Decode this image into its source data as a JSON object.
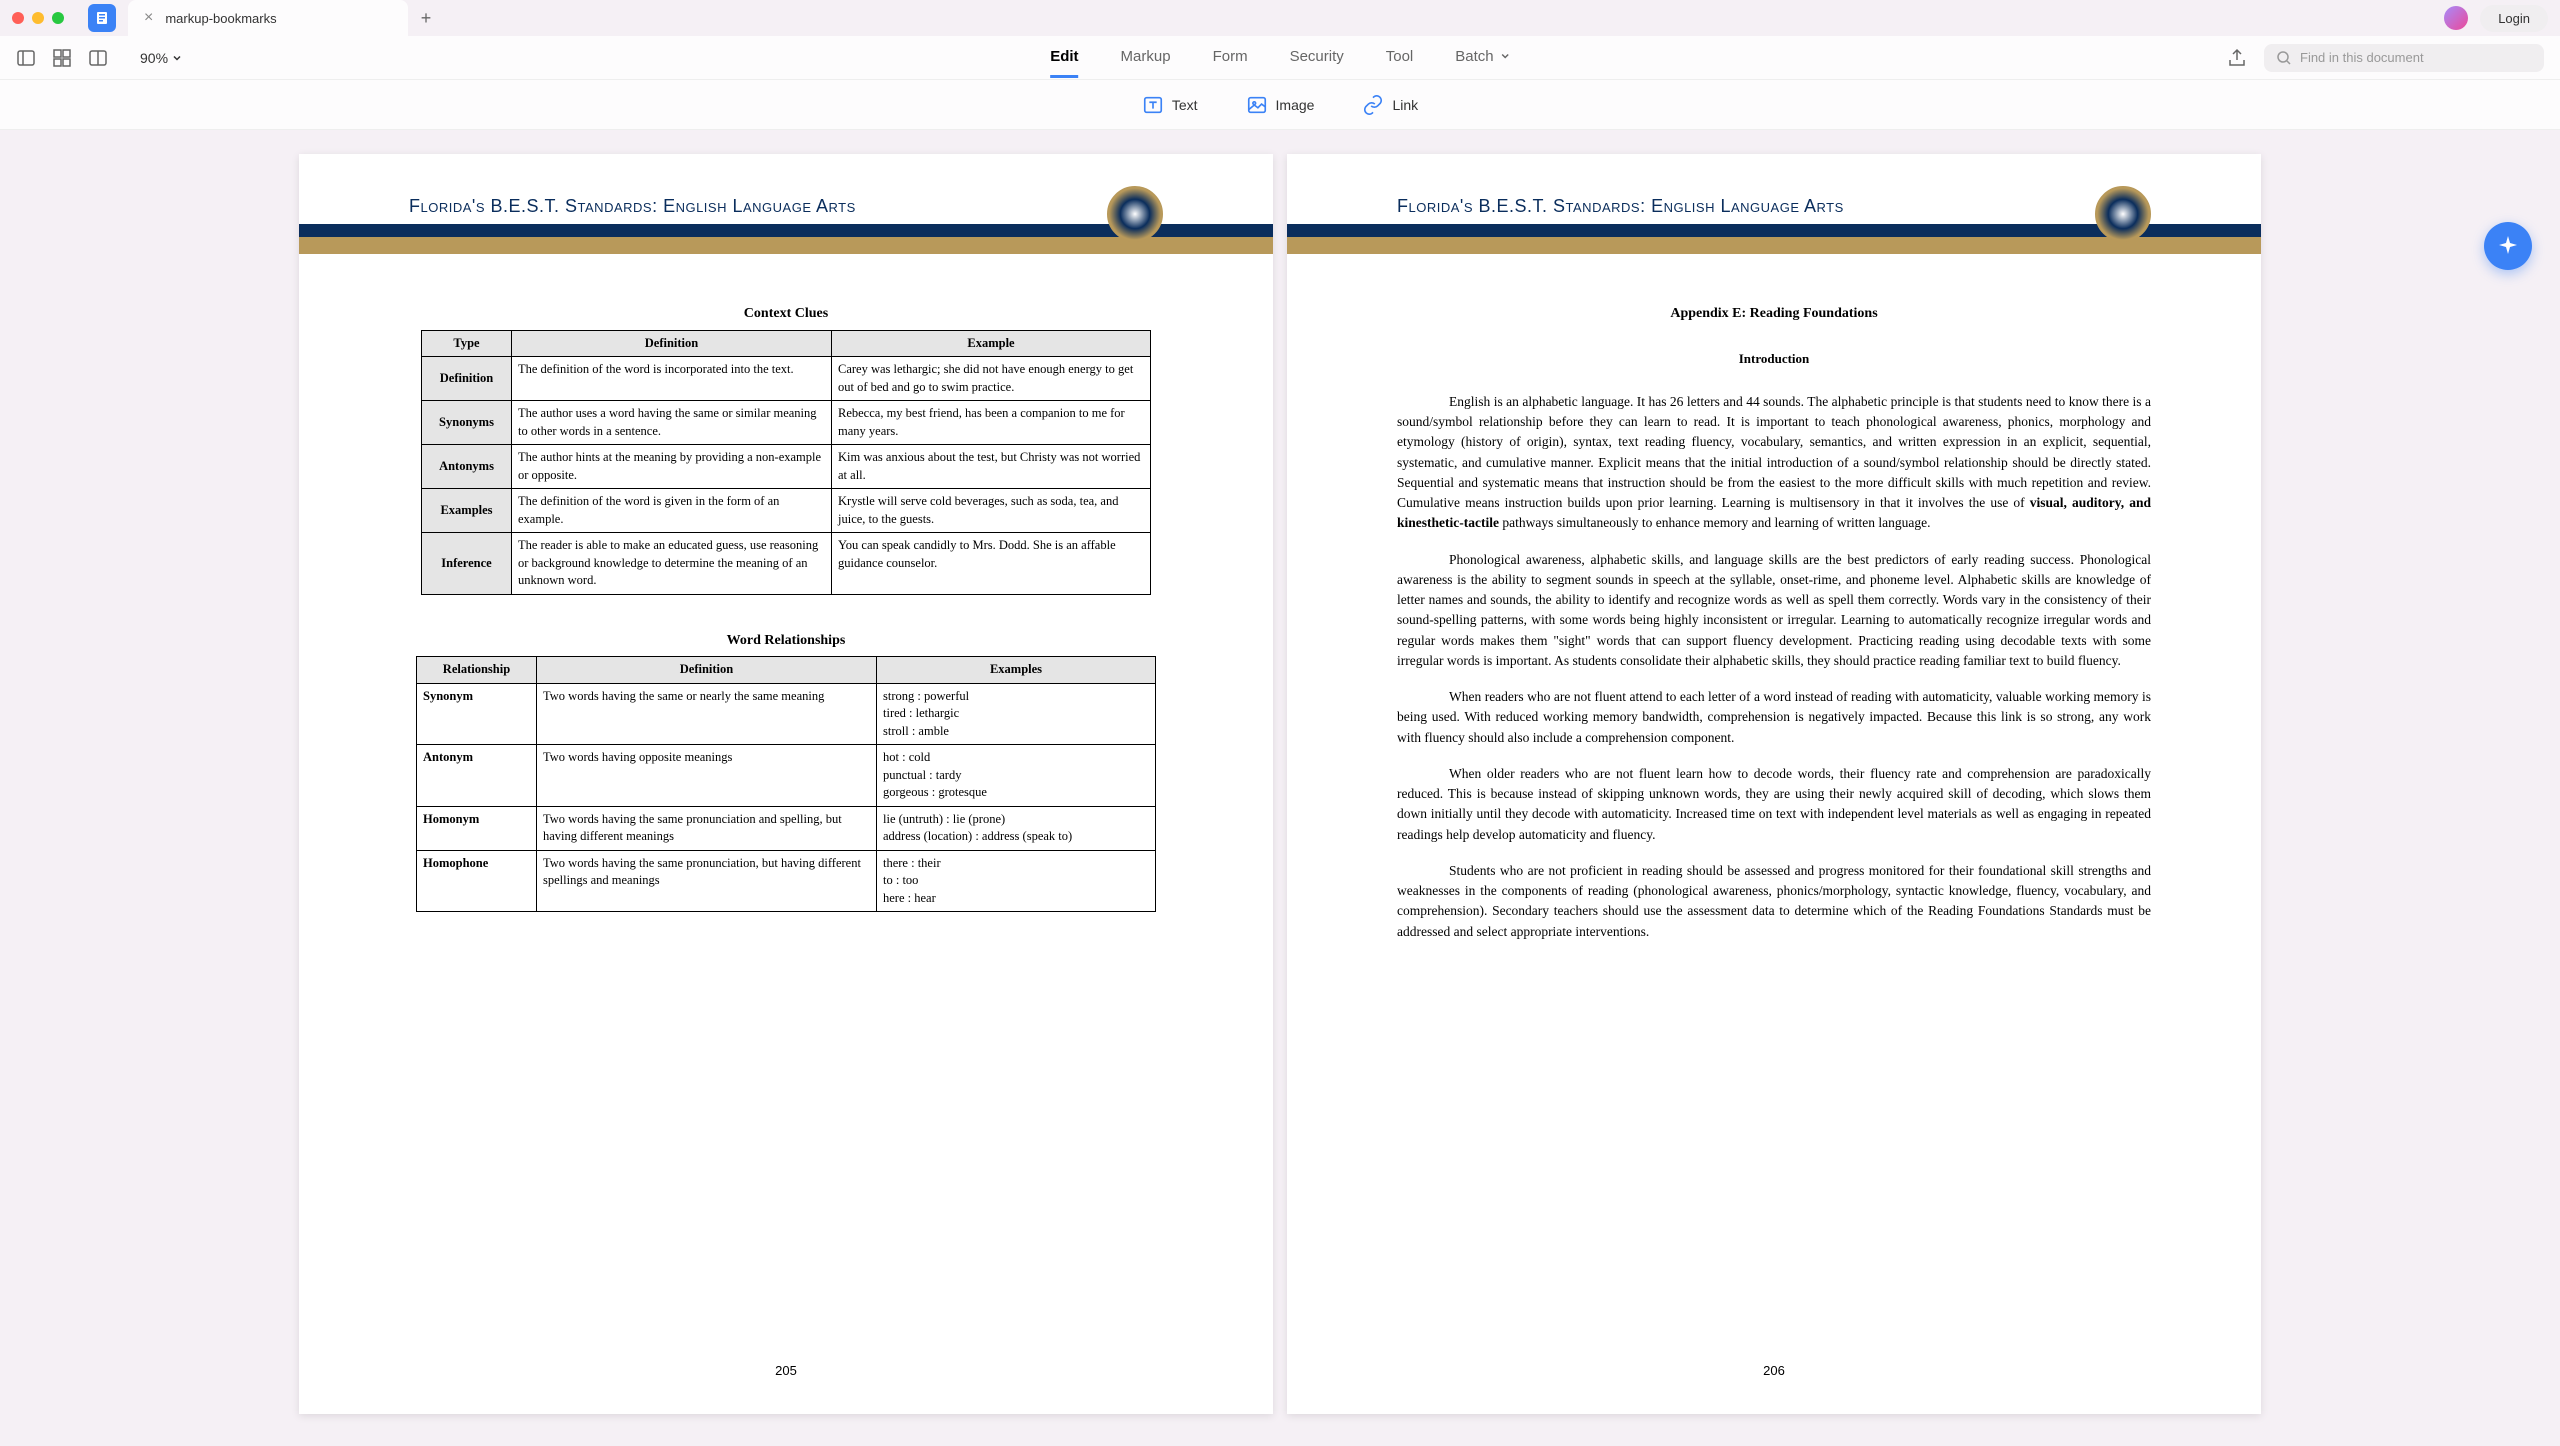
{
  "tab": {
    "title": "markup-bookmarks"
  },
  "login": "Login",
  "zoom": "90%",
  "menu": [
    "Edit",
    "Markup",
    "Form",
    "Security",
    "Tool",
    "Batch"
  ],
  "active_menu_index": 0,
  "tools": {
    "text": "Text",
    "image": "Image",
    "link": "Link"
  },
  "search": {
    "placeholder": "Find in this document"
  },
  "pages": {
    "left": {
      "header": "Florida's B.E.S.T. Standards: English Language Arts",
      "section1_title": "Context Clues",
      "table1": {
        "headers": [
          "Type",
          "Definition",
          "Example"
        ],
        "rows": [
          [
            "Definition",
            "The definition of the word is incorporated into the text.",
            "Carey was lethargic; she did not have enough energy to get out of bed and go to swim practice."
          ],
          [
            "Synonyms",
            "The author uses a word having the same or similar meaning to other words in a sentence.",
            "Rebecca, my best friend, has been a companion to me for many years."
          ],
          [
            "Antonyms",
            "The author hints at the meaning by providing a non-example or opposite.",
            "Kim was anxious about the test, but Christy was not worried at all."
          ],
          [
            "Examples",
            "The definition of the word is given in the form of an example.",
            "Krystle will serve cold beverages, such as soda, tea, and juice, to the guests."
          ],
          [
            "Inference",
            "The reader is able to make an educated guess, use reasoning or background knowledge to determine the meaning of an unknown word.",
            "You can speak candidly to Mrs. Dodd. She is an affable guidance counselor."
          ]
        ]
      },
      "section2_title": "Word Relationships",
      "table2": {
        "headers": [
          "Relationship",
          "Definition",
          "Examples"
        ],
        "rows": [
          [
            "Synonym",
            "Two words having the same or nearly the same meaning",
            "strong : powerful\ntired : lethargic\nstroll : amble"
          ],
          [
            "Antonym",
            "Two words having opposite meanings",
            "hot : cold\npunctual : tardy\ngorgeous : grotesque"
          ],
          [
            "Homonym",
            "Two words having the same pronunciation and spelling, but having different meanings",
            "lie (untruth) : lie (prone)\naddress (location) : address (speak to)"
          ],
          [
            "Homophone",
            "Two words having the same pronunciation, but having different spellings and meanings",
            "there : their\nto : too\nhere : hear"
          ]
        ]
      },
      "page_num": "205"
    },
    "right": {
      "header": "Florida's B.E.S.T. Standards: English Language Arts",
      "appendix_title": "Appendix E: Reading Foundations",
      "intro_title": "Introduction",
      "para1_a": "English is an alphabetic language. It has 26 letters and 44 sounds. The alphabetic principle is that students need to know there is a sound/symbol relationship before they can learn to read. It is important to teach phonological awareness, phonics, morphology and etymology (history of origin), syntax, text reading fluency, vocabulary, semantics, and written expression in an explicit, sequential, systematic, and cumulative manner. Explicit means that the initial introduction of a sound/symbol relationship should be directly stated. Sequential and systematic means that instruction should be from the easiest to the more difficult skills with much repetition and review. Cumulative means instruction builds upon prior learning. Learning is multisensory in that it involves the use of ",
      "para1_b": "visual, auditory, and kinesthetic-tactile",
      "para1_c": " pathways simultaneously to enhance memory and learning of written language.",
      "para2": "Phonological awareness, alphabetic skills, and language skills are the best predictors of early reading success. Phonological awareness is the ability to segment sounds in speech at the syllable, onset-rime, and phoneme level. Alphabetic skills are knowledge of letter names and sounds, the ability to identify and recognize words as well as spell them correctly. Words vary in the consistency of their sound-spelling patterns, with some words being highly inconsistent or irregular. Learning to automatically recognize irregular words and regular words makes them \"sight\" words that can support fluency development. Practicing reading using decodable texts with some irregular words is important. As students consolidate their alphabetic skills, they should practice reading familiar text to build fluency.",
      "para3": "When readers who are not fluent attend to each letter of a word instead of reading with automaticity, valuable working memory is being used. With reduced working memory bandwidth, comprehension is negatively impacted. Because this link is so strong, any work with fluency should also include a comprehension component.",
      "para4": "When older readers who are not fluent learn how to decode words, their fluency rate and comprehension are paradoxically reduced. This is because instead of skipping unknown words, they are using their newly acquired skill of decoding, which slows them down initially until they decode with automaticity. Increased time on text with independent level materials as well as engaging in repeated readings help develop automaticity and fluency.",
      "para5": "Students who are not proficient in reading should be assessed and progress monitored for their foundational skill strengths and weaknesses in the components of reading (phonological awareness, phonics/morphology, syntactic knowledge, fluency, vocabulary, and comprehension). Secondary teachers should use the assessment data to determine which of the Reading Foundations Standards must be addressed and select appropriate interventions.",
      "page_num": "206"
    }
  }
}
